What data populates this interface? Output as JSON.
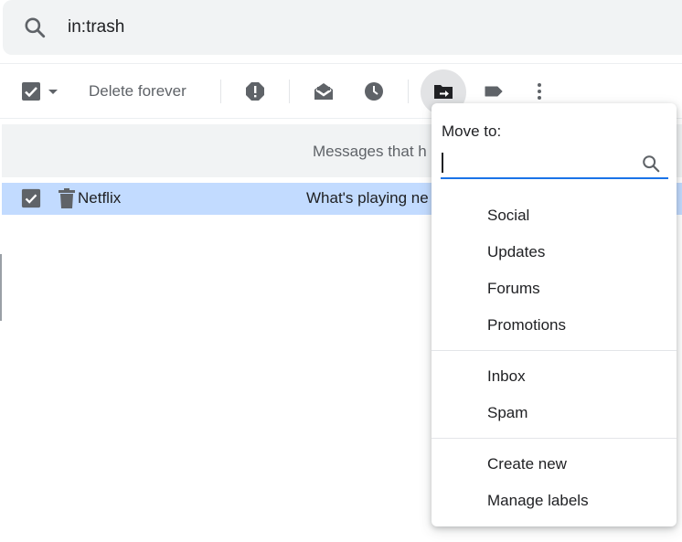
{
  "search": {
    "query": "in:trash"
  },
  "toolbar": {
    "delete_forever_label": "Delete forever"
  },
  "banner": {
    "text": "Messages that h"
  },
  "message": {
    "sender": "Netflix",
    "subject": "What's playing ne"
  },
  "move_menu": {
    "title": "Move to:",
    "search_value": "",
    "groups": [
      [
        "Social",
        "Updates",
        "Forums",
        "Promotions"
      ],
      [
        "Inbox",
        "Spam"
      ],
      [
        "Create new",
        "Manage labels"
      ]
    ]
  },
  "colors": {
    "selected_row": "#c2dbff",
    "accent": "#1a73e8",
    "icon_gray": "#5f6368"
  }
}
